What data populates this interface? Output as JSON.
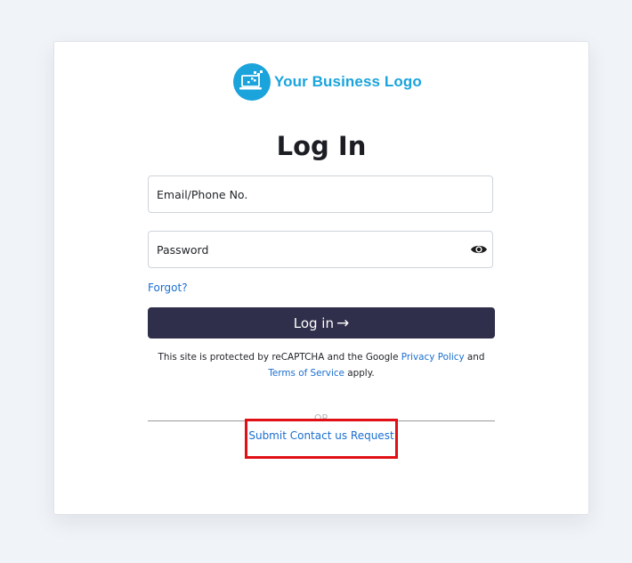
{
  "brand": {
    "logo_text": "Your Business Logo",
    "logo_color": "#1ba4dc",
    "logo_icon": "laptop-icon"
  },
  "login": {
    "title": "Log In",
    "email_placeholder": "Email/Phone No.",
    "password_placeholder": "Password",
    "password_toggle_icon": "eye-icon",
    "forgot_label": "Forgot?",
    "submit_label": "Log in",
    "submit_arrow": "→",
    "submit_bg": "#2f2f4b"
  },
  "recaptcha": {
    "prefix": "This site is protected by reCAPTCHA and the Google",
    "privacy_label": "Privacy Policy",
    "conjunction": "and",
    "terms_label": "Terms of Service",
    "suffix": "apply."
  },
  "alt_action": {
    "or_label": "OR",
    "contact_label": "Submit Contact us Request",
    "highlight_color": "#e01016"
  },
  "link_color": "#1a6fd1"
}
